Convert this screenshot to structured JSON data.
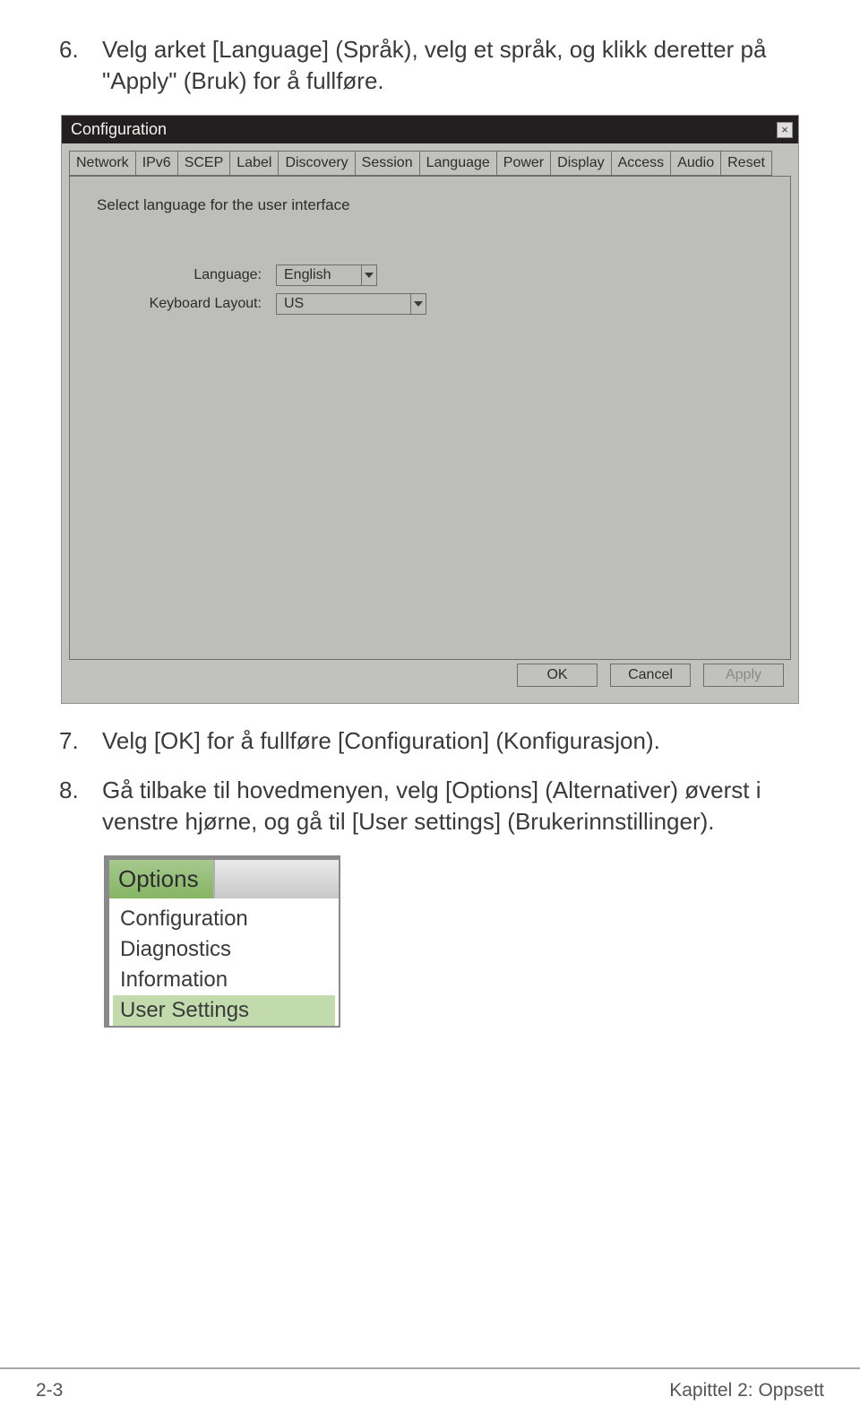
{
  "steps": {
    "s6": {
      "num": "6.",
      "text": "Velg arket [Language] (Språk), velg et språk, og klikk deretter på \"Apply\" (Bruk) for å fullføre."
    },
    "s7": {
      "num": "7.",
      "text": "Velg [OK] for å fullføre [Configuration] (Konfigurasjon)."
    },
    "s8": {
      "num": "8.",
      "text": "Gå tilbake til hovedmenyen, velg [Options] (Alternativer) øverst i venstre hjørne, og gå til [User settings] (Brukerinnstillinger)."
    }
  },
  "config_window": {
    "title": "Configuration",
    "close_glyph": "×",
    "tabs": [
      "Network",
      "IPv6",
      "SCEP",
      "Label",
      "Discovery",
      "Session",
      "Language",
      "Power",
      "Display",
      "Access",
      "Audio",
      "Reset"
    ],
    "panel_heading": "Select language for the user interface",
    "language_label": "Language:",
    "language_value": "English",
    "keyboard_label": "Keyboard Layout:",
    "keyboard_value": "US",
    "buttons": {
      "ok": "OK",
      "cancel": "Cancel",
      "apply": "Apply"
    }
  },
  "options_menu": {
    "title": "Options",
    "items": [
      "Configuration",
      "Diagnostics",
      "Information",
      "User Settings"
    ]
  },
  "footer": {
    "left": "2-3",
    "right": "Kapittel 2: Oppsett"
  }
}
